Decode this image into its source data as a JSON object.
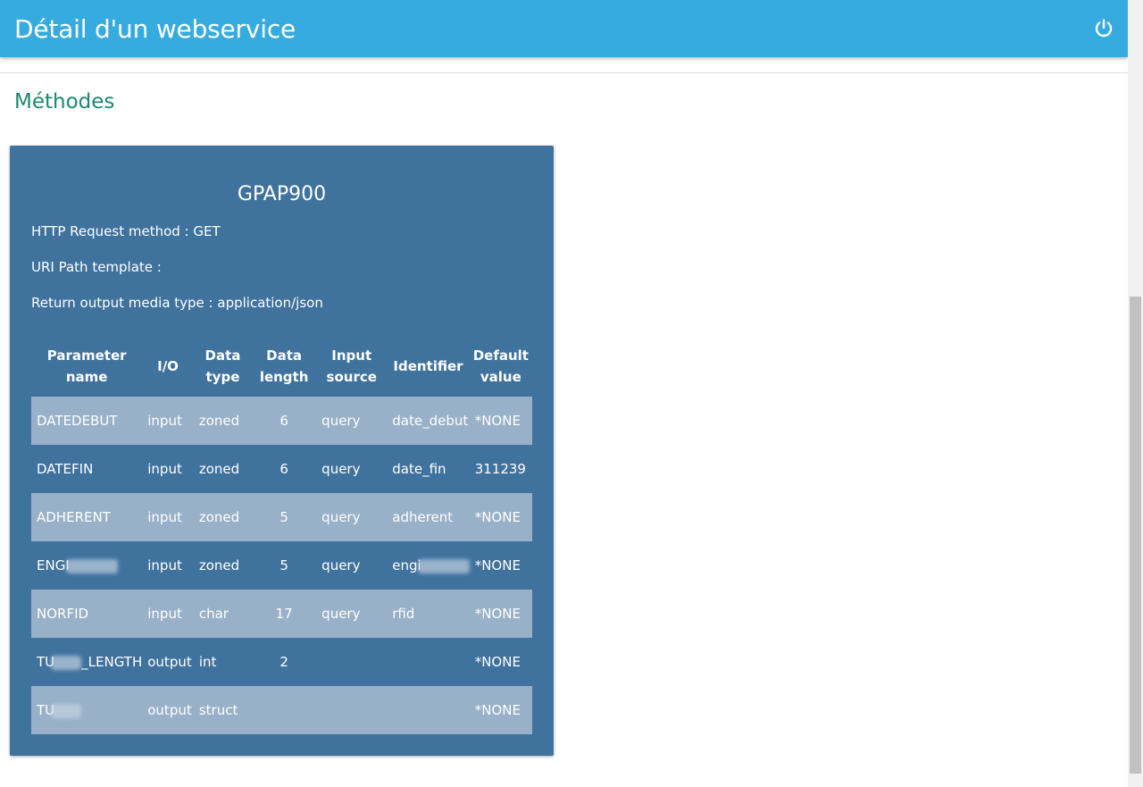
{
  "header": {
    "title": "Détail d'un webservice",
    "power_icon": "power-icon"
  },
  "section": {
    "title": "Méthodes"
  },
  "method": {
    "name": "GPAP900",
    "http_method_line": "HTTP Request method : GET",
    "uri_line": "URI Path template :",
    "media_line": "Return output media type : application/json"
  },
  "table": {
    "headers": {
      "param": "Parameter name",
      "io": "I/O",
      "dtype": "Data type",
      "dlen": "Data length",
      "src": "Input source",
      "ident": "Identifier",
      "def": "Default value"
    },
    "rows": [
      {
        "param": "DATEDEBUT",
        "io": "input",
        "dtype": "zoned",
        "dlen": "6",
        "src": "query",
        "ident": "date_debut",
        "def": "*NONE"
      },
      {
        "param": "DATEFIN",
        "io": "input",
        "dtype": "zoned",
        "dlen": "6",
        "src": "query",
        "ident": "date_fin",
        "def": "311239"
      },
      {
        "param": "ADHERENT",
        "io": "input",
        "dtype": "zoned",
        "dlen": "5",
        "src": "query",
        "ident": "adherent",
        "def": "*NONE"
      },
      {
        "param": "ENGI",
        "io": "input",
        "dtype": "zoned",
        "dlen": "5",
        "src": "query",
        "ident": "engi",
        "def": "*NONE"
      },
      {
        "param": "NORFID",
        "io": "input",
        "dtype": "char",
        "dlen": "17",
        "src": "query",
        "ident": "rfid",
        "def": "*NONE"
      },
      {
        "param_prefix": "TU",
        "param_suffix": "_LENGTH",
        "io": "output",
        "dtype": "int",
        "dlen": "2",
        "src": "",
        "ident": "",
        "def": "*NONE"
      },
      {
        "param_prefix": "TU",
        "io": "output",
        "dtype": "struct",
        "dlen": "",
        "src": "",
        "ident": "",
        "def": "*NONE"
      }
    ]
  },
  "colors": {
    "header_bg": "#35abe0",
    "section_title": "#1b8a6f",
    "card_bg": "#40729e",
    "row_stripe": "#98b0c8"
  }
}
